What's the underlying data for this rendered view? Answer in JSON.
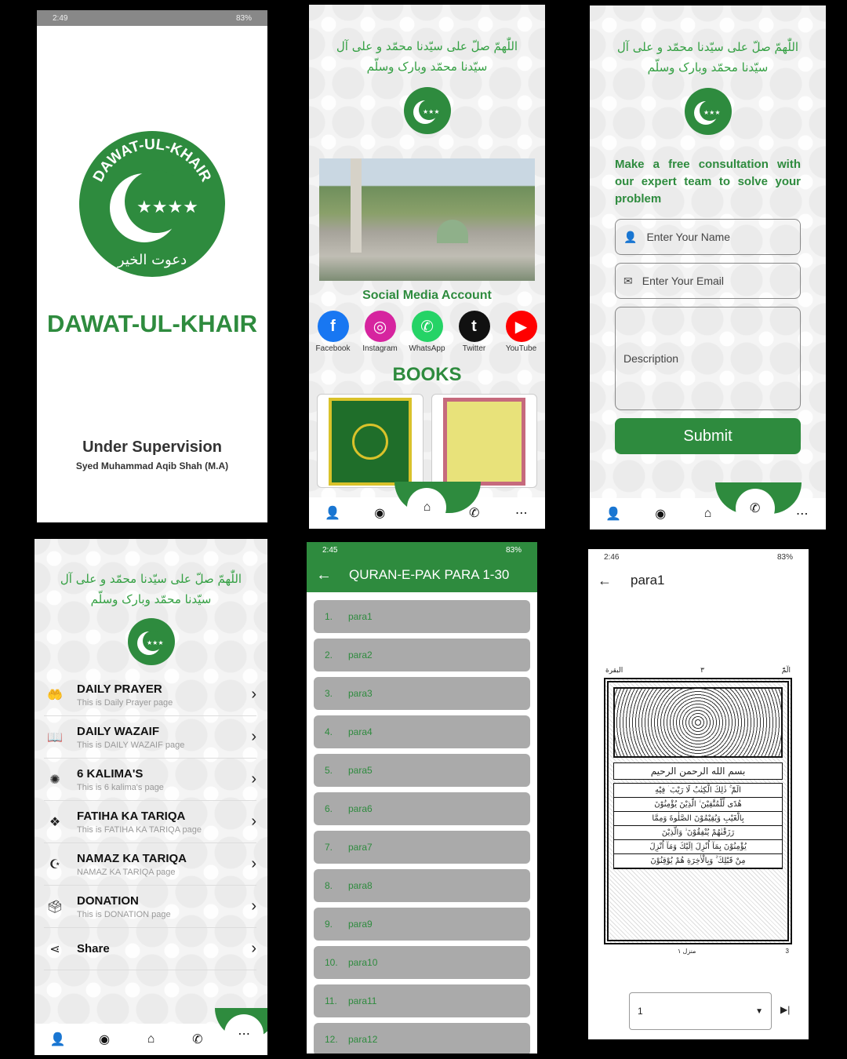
{
  "splash": {
    "status_time": "2:49",
    "status_battery": "83%",
    "logo_text": "DAWAT-UL-KHAIR",
    "logo_urdu": "دعوت الخیر",
    "title": "DAWAT-UL-KHAIR",
    "supervision_label": "Under Supervision",
    "supervisor": "Syed Muhammad Aqib Shah (M.A)"
  },
  "home": {
    "durood": "اللّٰهمّ صلّ علی سیّدنا محمّد و علی آل سیّدنا محمّد وبارک وسلّم",
    "social_title": "Social Media Account",
    "social": [
      {
        "label": "Facebook",
        "icon": "facebook-icon",
        "glyph": "f",
        "color": "#1877f2"
      },
      {
        "label": "Instagram",
        "icon": "instagram-icon",
        "glyph": "◎",
        "color": "#d6249f"
      },
      {
        "label": "WhatsApp",
        "icon": "whatsapp-icon",
        "glyph": "✆",
        "color": "#25d366"
      },
      {
        "label": "Twitter",
        "icon": "tumblr-icon",
        "glyph": "t",
        "color": "#111111"
      },
      {
        "label": "YouTube",
        "icon": "youtube-icon",
        "glyph": "▶",
        "color": "#ff0000"
      }
    ],
    "books_title": "BOOKS"
  },
  "contact": {
    "durood": "اللّٰهمّ صلّ علی سیّدنا محمّد و علی آل سیّدنا محمّد وبارک وسلّم",
    "heading": "Make a free consultation with our expert team to solve your problem",
    "name_placeholder": "Enter Your Name",
    "email_placeholder": "Enter Your Email",
    "description_placeholder": "Description",
    "submit_label": "Submit"
  },
  "menu": {
    "durood": "اللّٰهمّ صلّ علی سیّدنا محمّد و علی آل سیّدنا محمّد وبارک وسلّم",
    "items": [
      {
        "title": "DAILY PRAYER",
        "subtitle": "This is Daily Prayer page",
        "icon": "prayer-hands-icon",
        "glyph": "🤲"
      },
      {
        "title": "DAILY WAZAIF",
        "subtitle": "This is DAILY WAZAIF page",
        "icon": "book-icon",
        "glyph": "📖"
      },
      {
        "title": "6 KALIMA'S",
        "subtitle": "This is 6 kalima's page",
        "icon": "kalima-icon",
        "glyph": "✺"
      },
      {
        "title": "FATIHA KA TARIQA",
        "subtitle": "This is FATIHA KA TARIQA page",
        "icon": "fatiha-icon",
        "glyph": "❖"
      },
      {
        "title": "NAMAZ KA TARIQA",
        "subtitle": "NAMAZ KA TARIQA page",
        "icon": "namaz-icon",
        "glyph": "☪"
      },
      {
        "title": "DONATION",
        "subtitle": "This is DONATION page",
        "icon": "donation-box-icon",
        "glyph": "🗳"
      },
      {
        "title": "Share",
        "subtitle": "",
        "icon": "share-icon",
        "glyph": "⋖"
      }
    ]
  },
  "quran": {
    "status_time": "2:45",
    "status_battery": "83%",
    "title": "QURAN-E-PAK PARA 1-30",
    "paras": [
      {
        "num": "1.",
        "label": "para1"
      },
      {
        "num": "2.",
        "label": "para2"
      },
      {
        "num": "3.",
        "label": "para3"
      },
      {
        "num": "4.",
        "label": "para4"
      },
      {
        "num": "5.",
        "label": "para5"
      },
      {
        "num": "6.",
        "label": "para6"
      },
      {
        "num": "7.",
        "label": "para7"
      },
      {
        "num": "8.",
        "label": "para8"
      },
      {
        "num": "9.",
        "label": "para9"
      },
      {
        "num": "10.",
        "label": "para10"
      },
      {
        "num": "11.",
        "label": "para11"
      },
      {
        "num": "12.",
        "label": "para12"
      }
    ]
  },
  "reader": {
    "status_time": "2:46",
    "status_battery": "83%",
    "title": "para1",
    "page_header_right": "الٓمّٓ",
    "page_header_center": "٣",
    "page_header_left": "البقرة",
    "basmala": "بسم الله الرحمن الرحيم",
    "verse_lines": [
      "الٓمّٓ ۚ ذٰلِكَ الْكِتٰبُ لَا رَيْبَ ۛ فِيْهِ",
      "هُدًى لِّلْمُتَّقِيْنَ ۙ الَّذِيْنَ يُؤْمِنُوْنَ",
      "بِالْغَيْبِ وَيُقِيْمُوْنَ الصَّلٰوةَ وَمِمَّا",
      "رَزَقْنٰهُمْ يُنْفِقُوْنَ ۙ وَالَّذِيْنَ",
      "يُؤْمِنُوْنَ بِمَآ اُنْزِلَ اِلَيْكَ وَمَآ اُنْزِلَ",
      "مِنْ قَبْلِكَ ۚ وَبِالْاٰخِرَةِ هُمْ يُوْقِنُوْنَ"
    ],
    "page_footer": "منزل ١",
    "page_footer_num": "3",
    "page_select_value": "1"
  },
  "colors": {
    "accent": "#2e8b3e",
    "para_bg": "#aaaaaa"
  }
}
